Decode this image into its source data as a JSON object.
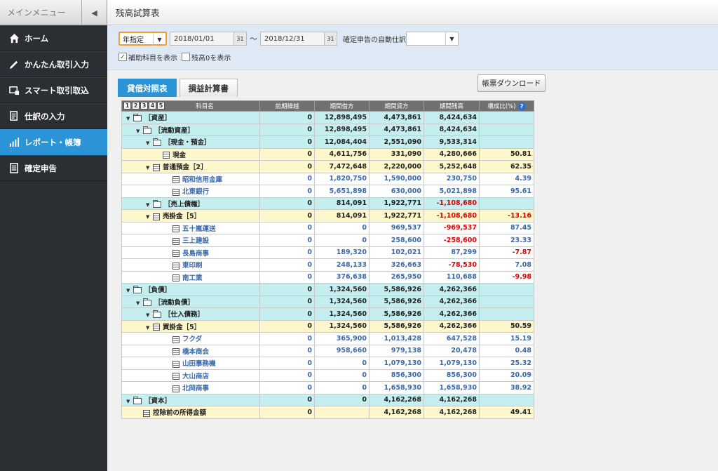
{
  "sidebar": {
    "header": "メインメニュー",
    "collapse_glyph": "◀",
    "items": [
      {
        "label": "ホーム",
        "icon": "home-icon",
        "active": false
      },
      {
        "label": "かんたん取引入力",
        "icon": "pencil-icon",
        "active": false
      },
      {
        "label": "スマート取引取込",
        "icon": "import-icon",
        "active": false
      },
      {
        "label": "仕訳の入力",
        "icon": "journal-icon",
        "active": false
      },
      {
        "label": "レポート・帳簿",
        "icon": "chart-icon",
        "active": true
      },
      {
        "label": "確定申告",
        "icon": "tax-return-icon",
        "active": false
      }
    ]
  },
  "page": {
    "title": "残高試算表"
  },
  "filters": {
    "period_type": "年指定",
    "start_date": "2018/01/01",
    "tilde": "〜",
    "end_date": "2018/12/31",
    "auto_journal_label": "確定申告の自動仕訳",
    "auto_journal_value": "",
    "show_sub_accounts_label": "補助科目を表示",
    "show_sub_accounts_checked": true,
    "show_zero_balance_label": "残高0を表示",
    "show_zero_balance_checked": false
  },
  "tabs": [
    {
      "label": "貸借対照表",
      "active": true
    },
    {
      "label": "損益計算書",
      "active": false
    }
  ],
  "download_label": "帳票ダウンロード",
  "table": {
    "page_buttons": [
      "1",
      "2",
      "3",
      "4",
      "5"
    ],
    "headers": [
      "科目名",
      "前期繰越",
      "期間借方",
      "期間貸方",
      "期間残高",
      "構成比(%)"
    ],
    "help_glyph": "?",
    "rows": [
      {
        "name": "［資産］",
        "indent": 0,
        "kind": "folder",
        "expand": true,
        "style": "a",
        "prev": "0",
        "debit": "12,898,495",
        "credit": "4,473,861",
        "balance": "8,424,634",
        "ratio": ""
      },
      {
        "name": "［流動資産］",
        "indent": 1,
        "kind": "folder",
        "expand": true,
        "style": "a",
        "prev": "0",
        "debit": "12,898,495",
        "credit": "4,473,861",
        "balance": "8,424,634",
        "ratio": ""
      },
      {
        "name": "［現金・預金］",
        "indent": 2,
        "kind": "folder",
        "expand": true,
        "style": "a",
        "prev": "0",
        "debit": "12,084,404",
        "credit": "2,551,090",
        "balance": "9,533,314",
        "ratio": ""
      },
      {
        "name": "現金",
        "indent": 3,
        "kind": "ledger",
        "expand": false,
        "style": "b",
        "prev": "0",
        "debit": "4,611,756",
        "credit": "331,090",
        "balance": "4,280,666",
        "ratio": "50.81"
      },
      {
        "name": "普通預金［2］",
        "indent": 2,
        "kind": "ledger",
        "expand": true,
        "style": "b",
        "prev": "0",
        "debit": "7,472,648",
        "credit": "2,220,000",
        "balance": "5,252,648",
        "ratio": "62.35"
      },
      {
        "name": "昭和信用金庫",
        "indent": 4,
        "kind": "ledger",
        "expand": false,
        "style": "c",
        "prev": "0",
        "debit": "1,820,750",
        "credit": "1,590,000",
        "balance": "230,750",
        "ratio": "4.39"
      },
      {
        "name": "北東銀行",
        "indent": 4,
        "kind": "ledger",
        "expand": false,
        "style": "c",
        "prev": "0",
        "debit": "5,651,898",
        "credit": "630,000",
        "balance": "5,021,898",
        "ratio": "95.61"
      },
      {
        "name": "［売上債権］",
        "indent": 2,
        "kind": "folder",
        "expand": true,
        "style": "a",
        "prev": "0",
        "debit": "814,091",
        "credit": "1,922,771",
        "balance": "-1,108,680",
        "ratio": ""
      },
      {
        "name": "売掛金［5］",
        "indent": 2,
        "kind": "ledger",
        "expand": true,
        "style": "b",
        "prev": "0",
        "debit": "814,091",
        "credit": "1,922,771",
        "balance": "-1,108,680",
        "ratio": "-13.16"
      },
      {
        "name": "五十嵐運送",
        "indent": 4,
        "kind": "ledger",
        "expand": false,
        "style": "c",
        "prev": "0",
        "debit": "0",
        "credit": "969,537",
        "balance": "-969,537",
        "ratio": "87.45"
      },
      {
        "name": "三上建設",
        "indent": 4,
        "kind": "ledger",
        "expand": false,
        "style": "c",
        "prev": "0",
        "debit": "0",
        "credit": "258,600",
        "balance": "-258,600",
        "ratio": "23.33"
      },
      {
        "name": "長島商事",
        "indent": 4,
        "kind": "ledger",
        "expand": false,
        "style": "c",
        "prev": "0",
        "debit": "189,320",
        "credit": "102,021",
        "balance": "87,299",
        "ratio": "-7.87"
      },
      {
        "name": "東印刷",
        "indent": 4,
        "kind": "ledger",
        "expand": false,
        "style": "c",
        "prev": "0",
        "debit": "248,133",
        "credit": "326,663",
        "balance": "-78,530",
        "ratio": "7.08"
      },
      {
        "name": "南工業",
        "indent": 4,
        "kind": "ledger",
        "expand": false,
        "style": "c",
        "prev": "0",
        "debit": "376,638",
        "credit": "265,950",
        "balance": "110,688",
        "ratio": "-9.98"
      },
      {
        "name": "［負債］",
        "indent": 0,
        "kind": "folder",
        "expand": true,
        "style": "a",
        "prev": "0",
        "debit": "1,324,560",
        "credit": "5,586,926",
        "balance": "4,262,366",
        "ratio": ""
      },
      {
        "name": "［流動負債］",
        "indent": 1,
        "kind": "folder",
        "expand": true,
        "style": "a",
        "prev": "0",
        "debit": "1,324,560",
        "credit": "5,586,926",
        "balance": "4,262,366",
        "ratio": ""
      },
      {
        "name": "［仕入債務］",
        "indent": 2,
        "kind": "folder",
        "expand": true,
        "style": "a",
        "prev": "0",
        "debit": "1,324,560",
        "credit": "5,586,926",
        "balance": "4,262,366",
        "ratio": ""
      },
      {
        "name": "買掛金［5］",
        "indent": 2,
        "kind": "ledger",
        "expand": true,
        "style": "b",
        "prev": "0",
        "debit": "1,324,560",
        "credit": "5,586,926",
        "balance": "4,262,366",
        "ratio": "50.59"
      },
      {
        "name": "フクダ",
        "indent": 4,
        "kind": "ledger",
        "expand": false,
        "style": "c",
        "prev": "0",
        "debit": "365,900",
        "credit": "1,013,428",
        "balance": "647,528",
        "ratio": "15.19"
      },
      {
        "name": "橋本商会",
        "indent": 4,
        "kind": "ledger",
        "expand": false,
        "style": "c",
        "prev": "0",
        "debit": "958,660",
        "credit": "979,138",
        "balance": "20,478",
        "ratio": "0.48"
      },
      {
        "name": "山田事務機",
        "indent": 4,
        "kind": "ledger",
        "expand": false,
        "style": "c",
        "prev": "0",
        "debit": "0",
        "credit": "1,079,130",
        "balance": "1,079,130",
        "ratio": "25.32"
      },
      {
        "name": "大山商店",
        "indent": 4,
        "kind": "ledger",
        "expand": false,
        "style": "c",
        "prev": "0",
        "debit": "0",
        "credit": "856,300",
        "balance": "856,300",
        "ratio": "20.09"
      },
      {
        "name": "北岡商事",
        "indent": 4,
        "kind": "ledger",
        "expand": false,
        "style": "c",
        "prev": "0",
        "debit": "0",
        "credit": "1,658,930",
        "balance": "1,658,930",
        "ratio": "38.92"
      },
      {
        "name": "［資本］",
        "indent": 0,
        "kind": "folder",
        "expand": true,
        "style": "a",
        "prev": "0",
        "debit": "0",
        "credit": "4,162,268",
        "balance": "4,162,268",
        "ratio": ""
      },
      {
        "name": "控除前の所得金額",
        "indent": 1,
        "kind": "ledger",
        "expand": false,
        "style": "b",
        "prev": "0",
        "debit": "",
        "credit": "4,162,268",
        "balance": "4,162,268",
        "ratio": "49.41"
      }
    ]
  }
}
